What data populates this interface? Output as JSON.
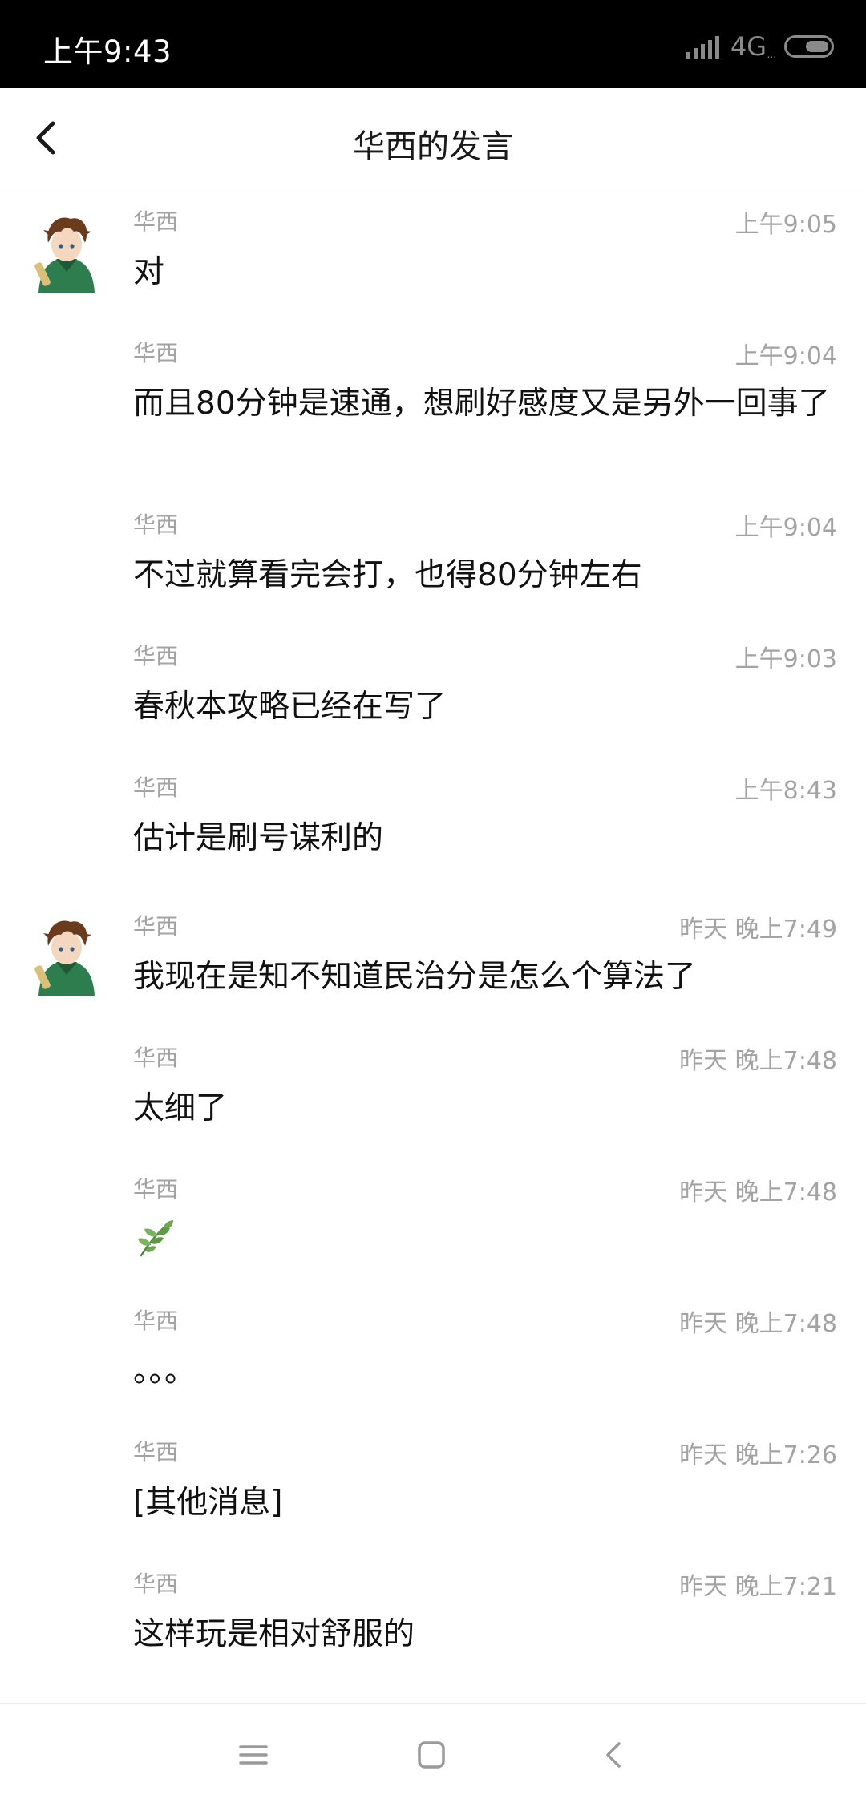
{
  "status_bar": {
    "time": "上午9:43",
    "network": "4G",
    "network_sub": "..."
  },
  "header": {
    "title": "华西的发言"
  },
  "groups": [
    {
      "messages": [
        {
          "sender": "华西",
          "time": "上午9:05",
          "text": "对"
        },
        {
          "sender": "华西",
          "time": "上午9:04",
          "text": "而且80分钟是速通，想刷好感度又是另外一回事了"
        },
        {
          "sender": "华西",
          "time": "上午9:04",
          "text": "不过就算看完会打，也得80分钟左右"
        },
        {
          "sender": "华西",
          "time": "上午9:03",
          "text": "春秋本攻略已经在写了"
        },
        {
          "sender": "华西",
          "time": "上午8:43",
          "text": "估计是刷号谋利的"
        }
      ]
    },
    {
      "messages": [
        {
          "sender": "华西",
          "time": "昨天 晚上7:49",
          "text": "我现在是知不知道民治分是怎么个算法了"
        },
        {
          "sender": "华西",
          "time": "昨天 晚上7:48",
          "text": "太细了"
        },
        {
          "sender": "华西",
          "time": "昨天 晚上7:48",
          "text": "",
          "sticker": "sprout-icon"
        },
        {
          "sender": "华西",
          "time": "昨天 晚上7:48",
          "text": "。。。"
        },
        {
          "sender": "华西",
          "time": "昨天 晚上7:26",
          "text": "[其他消息]"
        },
        {
          "sender": "华西",
          "time": "昨天 晚上7:21",
          "text": "这样玩是相对舒服的"
        }
      ]
    }
  ],
  "colors": {
    "status_bar_bg": "#000000",
    "meta_text": "#a3a3a3",
    "body_text": "#111111",
    "avatar_cloak": "#2e7d4f"
  },
  "nav": {
    "icons": [
      "menu-icon",
      "home-icon",
      "back-icon"
    ]
  }
}
